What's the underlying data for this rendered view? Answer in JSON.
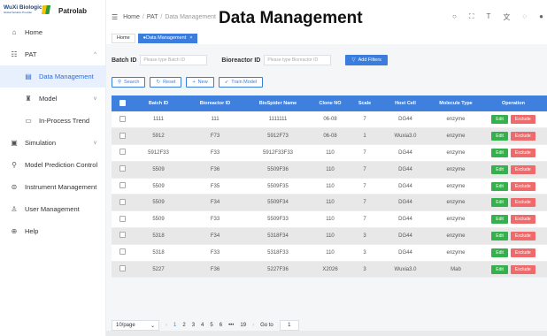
{
  "sidebar": {
    "logo_text": "WuXi Biologics",
    "logo_sub": "Global Solution Provider",
    "app_name": "Patrolab",
    "items": [
      {
        "label": "Home",
        "icon": "home-icon"
      },
      {
        "label": "PAT",
        "icon": "pat-icon"
      },
      {
        "label": "Data Management",
        "icon": "document-icon"
      },
      {
        "label": "Model",
        "icon": "model-icon"
      },
      {
        "label": "In-Process Trend",
        "icon": "trend-icon"
      },
      {
        "label": "Simulation",
        "icon": "simulation-icon"
      },
      {
        "label": "Model Prediction Control",
        "icon": "prediction-icon"
      },
      {
        "label": "Instrument Management",
        "icon": "instrument-icon"
      },
      {
        "label": "User Management",
        "icon": "user-icon"
      },
      {
        "label": "Help",
        "icon": "help-icon"
      }
    ]
  },
  "header": {
    "breadcrumb": [
      "Home",
      "PAT",
      "Data Management"
    ],
    "overlay_title": "Data Management"
  },
  "tags": {
    "home": "Home",
    "active": "Data Management"
  },
  "filters": {
    "batch_label": "Batch ID",
    "batch_placeholder": "Please type Batch ID",
    "bioreactor_label": "Bioreactor ID",
    "bioreactor_placeholder": "Please type Bioreactor ID",
    "add_filters": "Add Filters"
  },
  "actions": {
    "search": "Search",
    "reset": "Reset",
    "new": "New",
    "train": "Train Model"
  },
  "table": {
    "columns": [
      "Batch ID",
      "Bioreactor ID",
      "BioSpider Name",
      "Clone NO",
      "Scale",
      "Host Cell",
      "Molecule Type",
      "Operation"
    ],
    "edit_label": "Edit",
    "exclude_label": "Exclude",
    "rows": [
      [
        "1111",
        "111",
        "1111111",
        "06-08",
        "7",
        "DG44",
        "enzyme"
      ],
      [
        "5912",
        "F73",
        "5912F73",
        "06-08",
        "1",
        "Wuxia3.0",
        "enzyme"
      ],
      [
        "5912F33",
        "F33",
        "5912F33F33",
        "110",
        "7",
        "DG44",
        "enzyme"
      ],
      [
        "5509",
        "F36",
        "5509F36",
        "110",
        "7",
        "DG44",
        "enzyme"
      ],
      [
        "5509",
        "F35",
        "5509F35",
        "110",
        "7",
        "DG44",
        "enzyme"
      ],
      [
        "5509",
        "F34",
        "5509F34",
        "110",
        "7",
        "DG44",
        "enzyme"
      ],
      [
        "5509",
        "F33",
        "5509F33",
        "110",
        "7",
        "DG44",
        "enzyme"
      ],
      [
        "5318",
        "F34",
        "5318F34",
        "110",
        "3",
        "DG44",
        "enzyme"
      ],
      [
        "5318",
        "F33",
        "5318F33",
        "110",
        "3",
        "DG44",
        "enzyme"
      ],
      [
        "5227",
        "F36",
        "5227F36",
        "X2026",
        "3",
        "Wuxia3.0",
        "Mab"
      ]
    ]
  },
  "pagination": {
    "per_page": "10/page",
    "pages": [
      "1",
      "2",
      "3",
      "4",
      "5",
      "6",
      "•••",
      "19"
    ],
    "goto_label": "Go to",
    "goto_value": "1"
  }
}
